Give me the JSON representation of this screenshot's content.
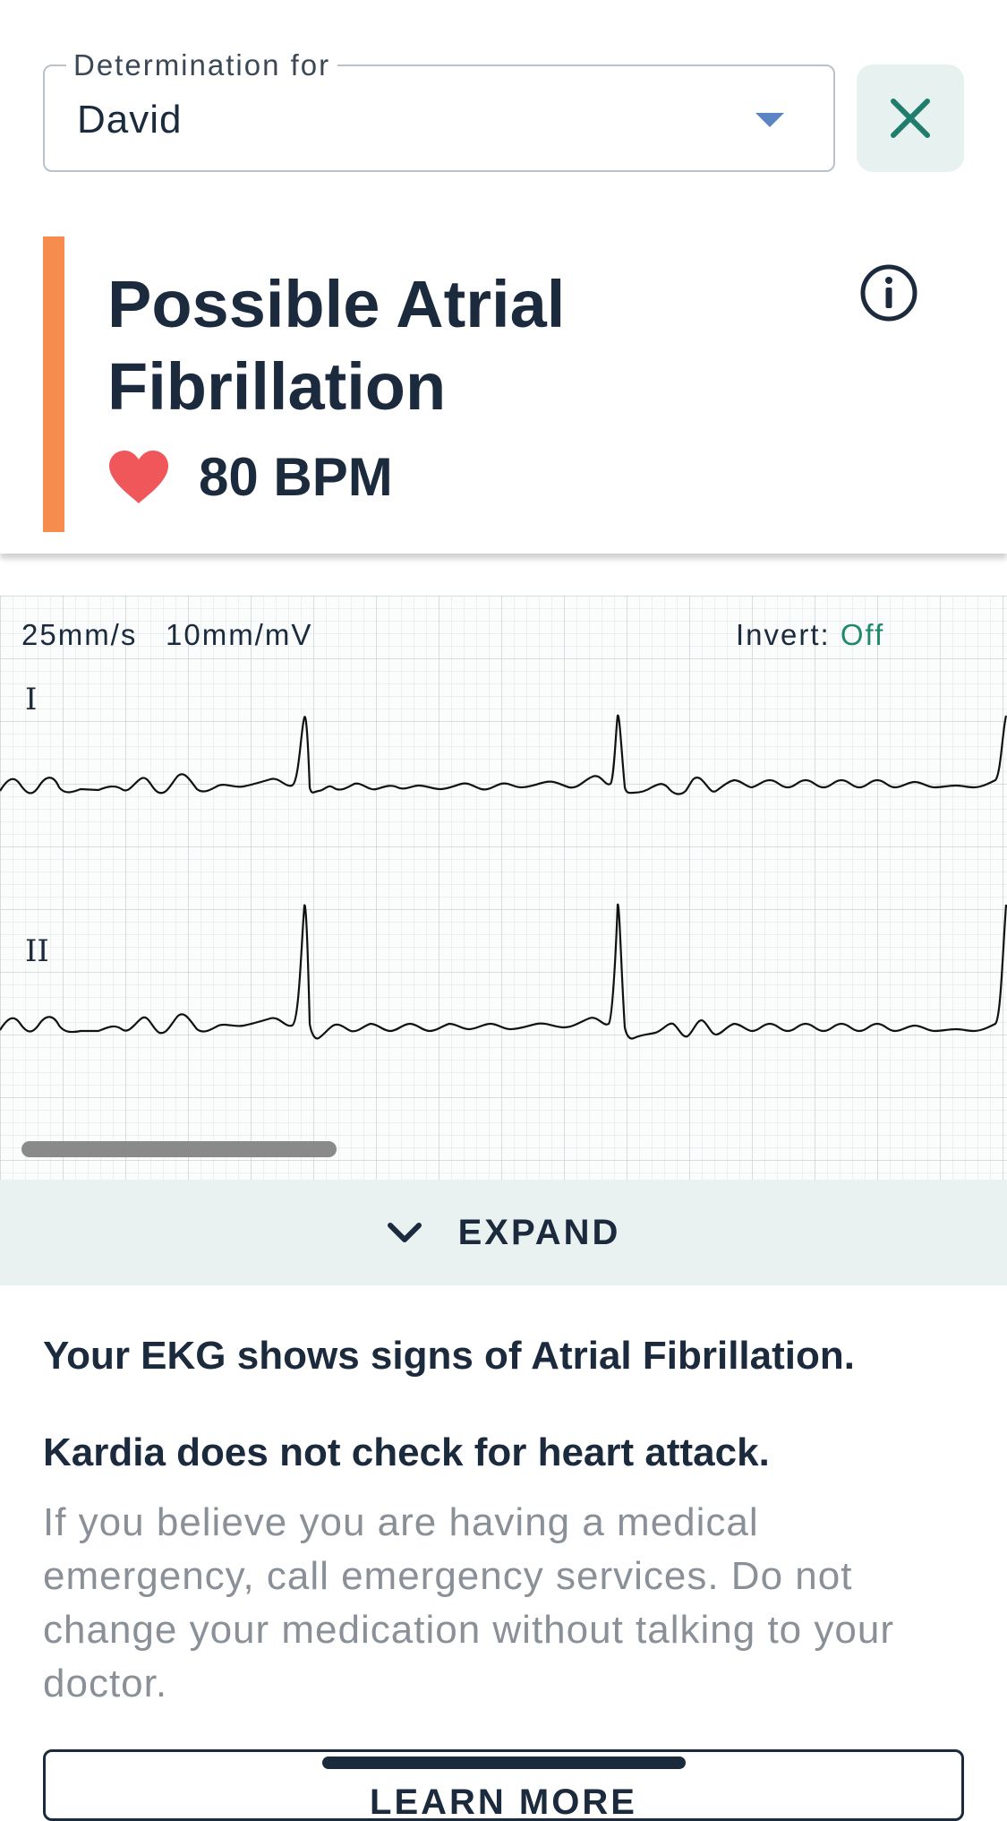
{
  "determination": {
    "legend": "Determination for",
    "value": "David"
  },
  "icons": {
    "caret": "caret-down-icon",
    "close": "close-icon",
    "info": "info-icon",
    "heart": "heart-icon",
    "chevron": "chevron-down-icon"
  },
  "result": {
    "title": "Possible Atrial Fibrillation",
    "bpm": "80 BPM",
    "accent_color": "#f78c4f"
  },
  "ekg": {
    "speed": "25mm/s",
    "gain": "10mm/mV",
    "invert_label": "Invert:",
    "invert_value": "Off",
    "leads": [
      "I",
      "II"
    ]
  },
  "expand": {
    "label": "EXPAND"
  },
  "messages": {
    "heading1": "Your EKG shows signs of Atrial Fibrillation.",
    "heading2": "Kardia does not check for heart attack.",
    "body": "If you believe you are having a medical emergency, call emergency services. Do not change your medication without talking to your doctor."
  },
  "learn_more": {
    "label": "LEARN MORE"
  },
  "colors": {
    "text": "#1b2a3d",
    "accent_green": "#1f8a6b",
    "heart": "#f0575b",
    "expand_bg": "#e9f2f1"
  }
}
